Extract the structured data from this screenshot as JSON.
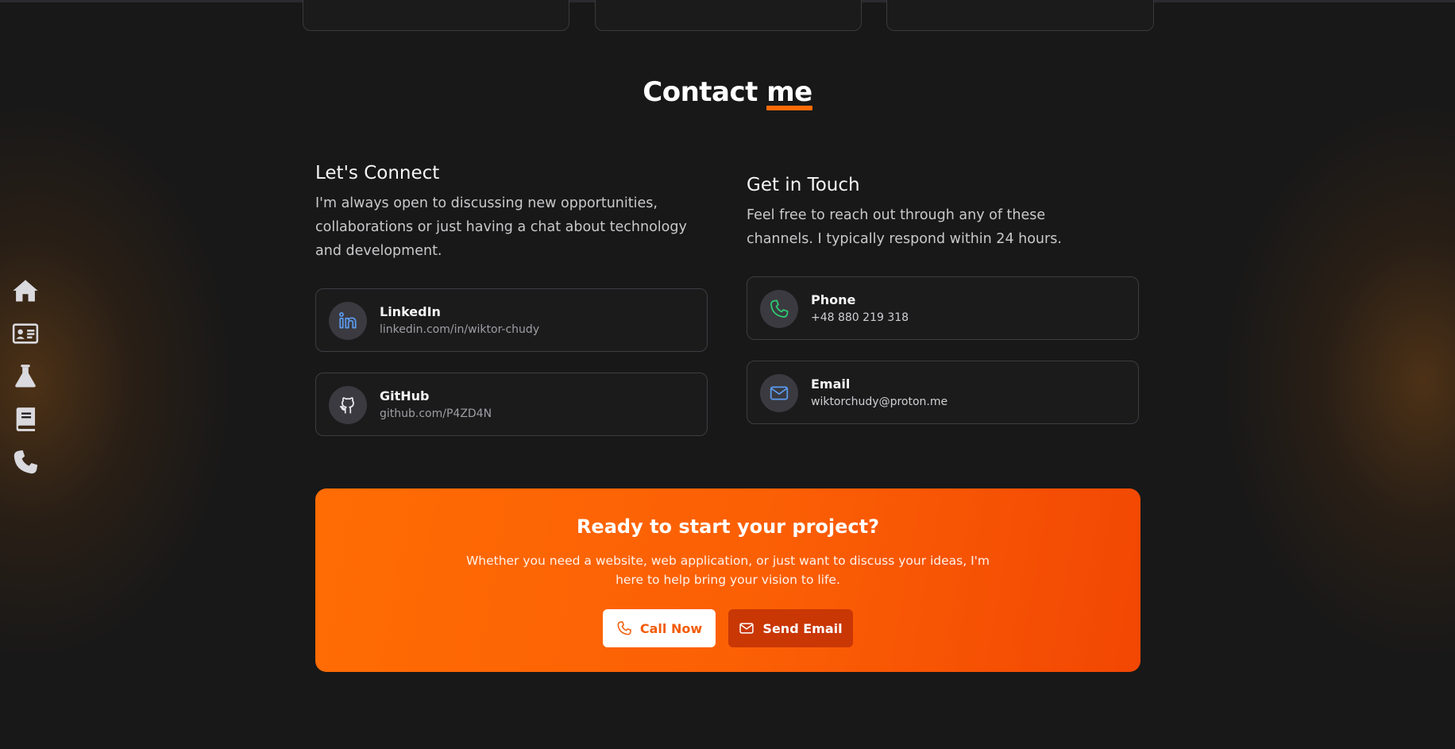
{
  "sidebar": {
    "items": [
      {
        "name": "home",
        "icon": "home-icon"
      },
      {
        "name": "about",
        "icon": "id-card-icon"
      },
      {
        "name": "projects",
        "icon": "flask-icon"
      },
      {
        "name": "blog",
        "icon": "book-icon"
      },
      {
        "name": "contact",
        "icon": "phone-icon"
      }
    ]
  },
  "section": {
    "title_main": "Contact ",
    "title_accent": "me"
  },
  "connect": {
    "heading": "Let's Connect",
    "text": "I'm always open to discussing new opportunities, collaborations or just having a chat about technology and development.",
    "cards": [
      {
        "label": "LinkedIn",
        "value": "linkedin.com/in/wiktor-chudy",
        "icon": "linkedin-icon"
      },
      {
        "label": "GitHub",
        "value": "github.com/P4ZD4N",
        "icon": "github-icon"
      }
    ]
  },
  "touch": {
    "heading": "Get in Touch",
    "text": "Feel free to reach out through any of these channels. I typically respond within 24 hours.",
    "cards": [
      {
        "label": "Phone",
        "value": "+48 880 219 318",
        "icon": "phone-icon"
      },
      {
        "label": "Email",
        "value": "wiktorchudy@proton.me",
        "icon": "mail-icon"
      }
    ]
  },
  "cta": {
    "title": "Ready to start your project?",
    "text": "Whether you need a website, web application, or just want to discuss your ideas, I'm here to help bring your vision to life.",
    "call_label": "Call Now",
    "email_label": "Send Email"
  },
  "colors": {
    "background": "#181818",
    "accent": "#ff6b08",
    "cta_gradient_start": "#ff6c04",
    "cta_gradient_end": "#f24703",
    "linkedin_icon": "#5b9bf0",
    "phone_icon": "#2fce72",
    "mail_icon": "#5b9bf0"
  }
}
